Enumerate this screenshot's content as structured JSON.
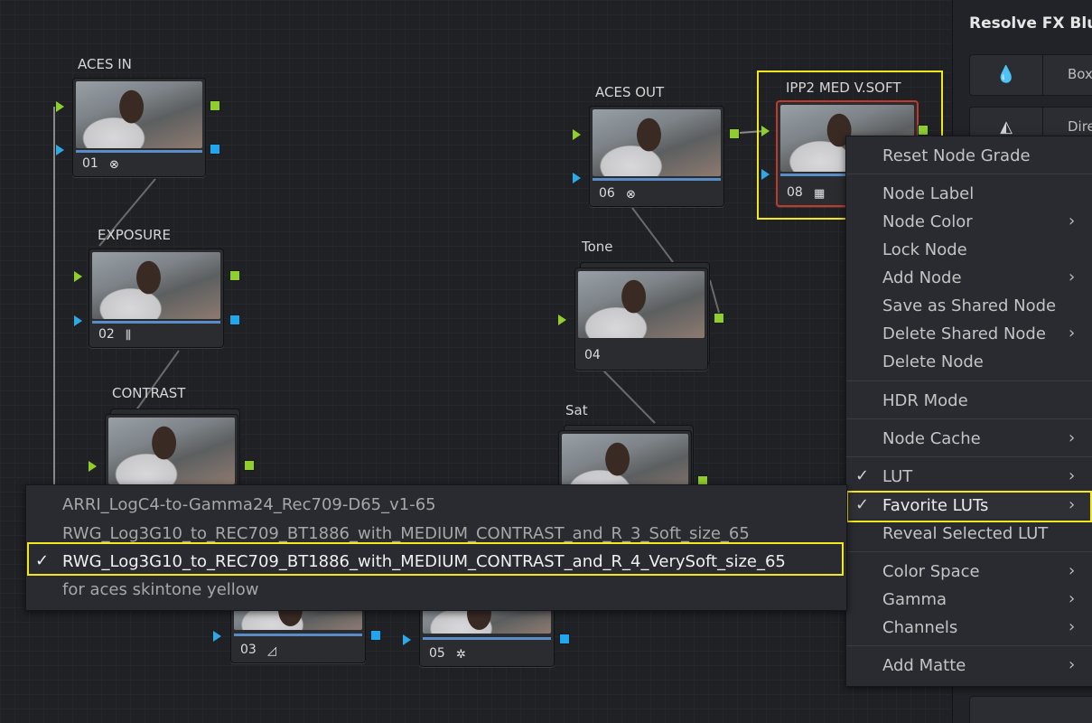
{
  "nodes": [
    {
      "id": "aces-in",
      "label": "ACES IN",
      "num": "01",
      "icon": "aces-icon",
      "glyph": "⊗"
    },
    {
      "id": "exposure",
      "label": "EXPOSURE",
      "num": "02",
      "icon": "levels-icon",
      "glyph": "⫼"
    },
    {
      "id": "contrast",
      "label": "CONTRAST",
      "num": "",
      "icon": "",
      "glyph": ""
    },
    {
      "id": "aces-out",
      "label": "ACES OUT",
      "num": "06",
      "icon": "aces-icon",
      "glyph": "⊗"
    },
    {
      "id": "tone",
      "label": "Tone",
      "num": "04",
      "icon": "",
      "glyph": ""
    },
    {
      "id": "sat",
      "label": "Sat",
      "num": "",
      "icon": "",
      "glyph": ""
    },
    {
      "id": "ipp2",
      "label": "IPP2 MED V.SOFT",
      "num": "08",
      "icon": "lut-grid-icon",
      "glyph": "▦"
    },
    {
      "id": "node03",
      "label": "",
      "num": "03",
      "icon": "curve-icon",
      "glyph": "◿"
    },
    {
      "id": "node05",
      "label": "",
      "num": "05",
      "icon": "hdr-wheel-icon",
      "glyph": "✲"
    }
  ],
  "right_panel": {
    "title": "Resolve FX Blu",
    "buttons": [
      {
        "icon": "drop-icon",
        "glyph": "💧",
        "label": "Box"
      },
      {
        "icon": "direction-icon",
        "glyph": "◭",
        "label": "Dire"
      }
    ]
  },
  "context_menu": {
    "items": [
      {
        "label": "Reset Node Grade",
        "check": "",
        "submenu": ""
      },
      {
        "label": "Node Label",
        "check": "",
        "submenu": ""
      },
      {
        "label": "Node Color",
        "check": "",
        "submenu": "›"
      },
      {
        "label": "Lock Node",
        "check": "",
        "submenu": ""
      },
      {
        "label": "Add Node",
        "check": "",
        "submenu": "›"
      },
      {
        "label": "Save as Shared Node",
        "check": "",
        "submenu": ""
      },
      {
        "label": "Delete Shared Node",
        "check": "",
        "submenu": "›"
      },
      {
        "label": "Delete Node",
        "check": "",
        "submenu": ""
      },
      {
        "label": "HDR Mode",
        "check": "",
        "submenu": ""
      },
      {
        "label": "Node Cache",
        "check": "",
        "submenu": "›"
      },
      {
        "label": "LUT",
        "check": "✓",
        "submenu": "›"
      },
      {
        "label": "Favorite LUTs",
        "check": "✓",
        "submenu": "›"
      },
      {
        "label": "Reveal Selected LUT",
        "check": "",
        "submenu": ""
      },
      {
        "label": "Color Space",
        "check": "",
        "submenu": "›"
      },
      {
        "label": "Gamma",
        "check": "",
        "submenu": "›"
      },
      {
        "label": "Channels",
        "check": "",
        "submenu": "›"
      },
      {
        "label": "Add Matte",
        "check": "",
        "submenu": "›"
      }
    ]
  },
  "lut_submenu": {
    "items": [
      {
        "label": "ARRI_LogC4-to-Gamma24_Rec709-D65_v1-65",
        "check": ""
      },
      {
        "label": "RWG_Log3G10_to_REC709_BT1886_with_MEDIUM_CONTRAST_and_R_3_Soft_size_65",
        "check": ""
      },
      {
        "label": "RWG_Log3G10_to_REC709_BT1886_with_MEDIUM_CONTRAST_and_R_4_VerySoft_size_65",
        "check": "✓"
      },
      {
        "label": "for aces skintone yellow",
        "check": ""
      }
    ]
  },
  "colors": {
    "highlight": "#f2e81f",
    "port_green": "#8fce2b",
    "port_blue": "#1fa6ee",
    "selected_node_border": "#c0392b"
  }
}
